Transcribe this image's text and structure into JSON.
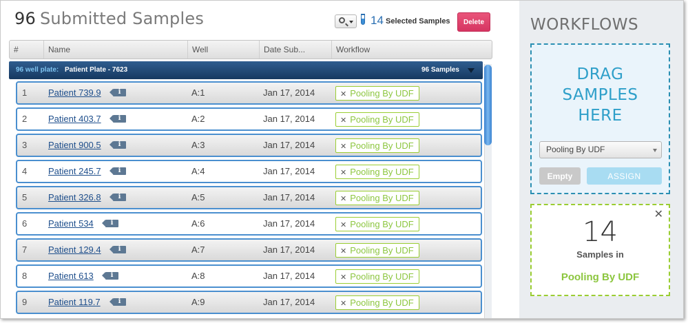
{
  "header": {
    "count": "96",
    "title": "Submitted Samples",
    "selected_count": "14",
    "selected_label": "Selected Samples",
    "delete_label": "Delete"
  },
  "table": {
    "columns": [
      "#",
      "Name",
      "Well",
      "Date Sub...",
      "Workflow"
    ],
    "group": {
      "type_label": "96 well plate:",
      "name": "Patient Plate - 7623",
      "count_label": "96 Samples"
    },
    "rows": [
      {
        "num": "1",
        "name": "Patient 739.9",
        "well": "A:1",
        "date": "Jan 17, 2014",
        "workflow": "Pooling By UDF"
      },
      {
        "num": "2",
        "name": "Patient 403.7",
        "well": "A:2",
        "date": "Jan 17, 2014",
        "workflow": "Pooling By UDF"
      },
      {
        "num": "3",
        "name": "Patient 900.5",
        "well": "A:3",
        "date": "Jan 17, 2014",
        "workflow": "Pooling By UDF"
      },
      {
        "num": "4",
        "name": "Patient 245.7",
        "well": "A:4",
        "date": "Jan 17, 2014",
        "workflow": "Pooling By UDF"
      },
      {
        "num": "5",
        "name": "Patient 326.8",
        "well": "A:5",
        "date": "Jan 17, 2014",
        "workflow": "Pooling By UDF"
      },
      {
        "num": "6",
        "name": "Patient 534",
        "well": "A:6",
        "date": "Jan 17, 2014",
        "workflow": "Pooling By UDF"
      },
      {
        "num": "7",
        "name": "Patient 129.4",
        "well": "A:7",
        "date": "Jan 17, 2014",
        "workflow": "Pooling By UDF"
      },
      {
        "num": "8",
        "name": "Patient 613",
        "well": "A:8",
        "date": "Jan 17, 2014",
        "workflow": "Pooling By UDF"
      },
      {
        "num": "9",
        "name": "Patient 119.7",
        "well": "A:9",
        "date": "Jan 17, 2014",
        "workflow": "Pooling By UDF"
      }
    ],
    "badge_remove_glyph": "✕",
    "info_glyph": "i"
  },
  "workflows": {
    "title": "WORKFLOWS",
    "drop_lines": [
      "DRAG",
      "SAMPLES",
      "HERE"
    ],
    "selected_workflow": "Pooling By UDF",
    "empty_label": "Empty",
    "assign_label": "ASSIGN",
    "summary": {
      "count": "14",
      "label": "Samples in",
      "workflow": "Pooling By UDF",
      "close_glyph": "✕"
    }
  },
  "colors": {
    "accent_blue": "#2a6fb2",
    "delete_pink": "#d63562",
    "workflow_green": "#8cc63f",
    "drop_teal": "#2e9fc9",
    "plate_bar_navy": "#163960"
  },
  "icons": [
    "search-icon",
    "chevron-down-icon",
    "test-tube-icon",
    "info-icon",
    "close-icon"
  ]
}
